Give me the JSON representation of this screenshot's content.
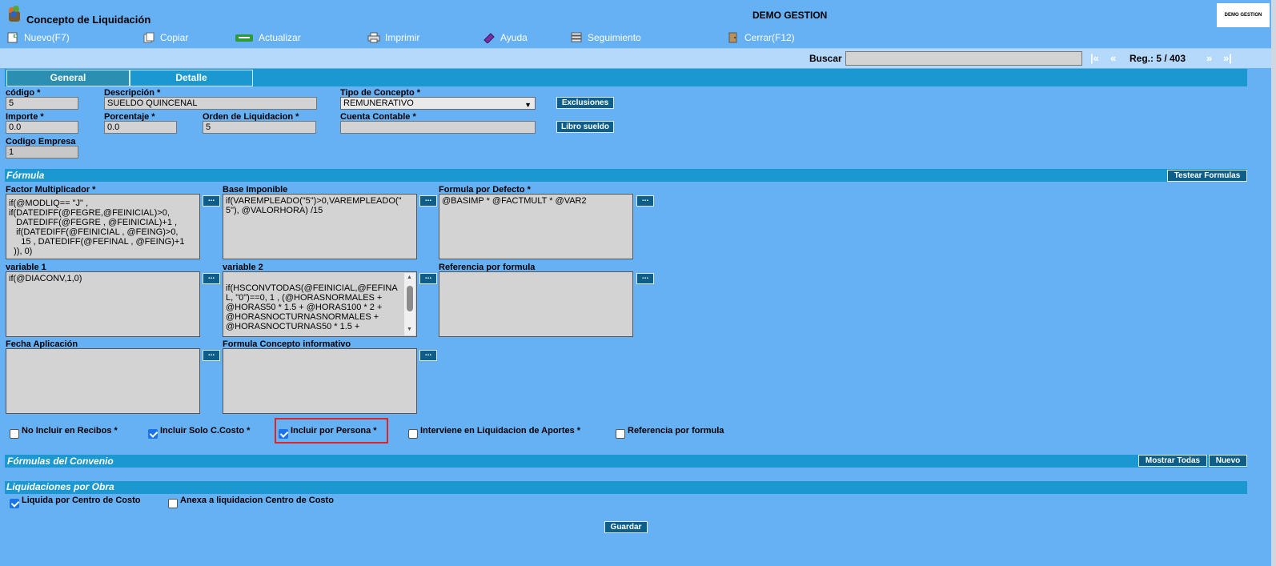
{
  "window": {
    "title": "Concepto de Liquidación",
    "company": "DEMO GESTION",
    "logo_text": "DEMO GESTION"
  },
  "toolbar": {
    "nuevo": "Nuevo(F7)",
    "copiar": "Copiar",
    "actualizar": "Actualizar",
    "imprimir": "Imprimir",
    "ayuda": "Ayuda",
    "seguimiento": "Seguimiento",
    "cerrar": "Cerrar(F12)"
  },
  "search": {
    "label": "Buscar",
    "value": "",
    "first": "|«",
    "prev": "«",
    "next": "»",
    "last": "»|",
    "reg": "Reg.: 5 / 403"
  },
  "tabs": {
    "general": "General",
    "detalle": "Detalle"
  },
  "form": {
    "codigo_label": "código *",
    "codigo": "5",
    "descripcion_label": "Descripción *",
    "descripcion": "SUELDO QUINCENAL",
    "tipo_label": "Tipo de Concepto *",
    "tipo": "REMUNERATIVO",
    "exclusiones": "Exclusiones",
    "importe_label": "Importe *",
    "importe": "0.0",
    "porcentaje_label": "Porcentaje *",
    "porcentaje": "0.0",
    "orden_label": "Orden de Liquidacion *",
    "orden": "5",
    "cuenta_label": "Cuenta Contable *",
    "cuenta": "",
    "libro_sueldo": "Libro sueldo",
    "empresa_label": "Codigo Empresa",
    "empresa": "1"
  },
  "formula": {
    "title": "Fórmula",
    "testear": "Testear Formulas",
    "dots": "...",
    "factor_label": "Factor Multiplicador *",
    "factor": "if(@MODLIQ== \"J\" ,\nif(DATEDIFF(@FEGRE,@FEINICIAL)>0,\n   DATEDIFF(@FEGRE , @FEINICIAL)+1 ,\n   if(DATEDIFF(@FEINICIAL , @FEING)>0,\n     15 , DATEDIFF(@FEFINAL , @FEING)+1\n  )), 0)",
    "base_label": "Base Imponible",
    "base": "if(VAREMPLEADO(\"5\")>0,VAREMPLEADO(\"\n5\"), @VALORHORA) /15",
    "defecto_label": "Formula por Defecto *",
    "defecto": "@BASIMP * @FACTMULT * @VAR2",
    "var1_label": "variable 1",
    "var1": "if(@DIACONV,1,0)",
    "var2_label": "variable 2",
    "var2": "if(HSCONVTODAS(@FEINICIAL,@FEFINA\nL, \"0\")==0, 1 , (@HORASNORMALES +\n@HORAS50 * 1.5 + @HORAS100 * 2 +\n@HORASNOCTURNASNORMALES +\n@HORASNOCTURNAS50 * 1.5 +",
    "referencia_label": "Referencia por formula",
    "referencia": "",
    "fecha_label": "Fecha Aplicación",
    "fecha": "",
    "informativo_label": "Formula Concepto informativo",
    "informativo": ""
  },
  "checks": {
    "no_incluir": "No Incluir en Recibos *",
    "solo_ccosto": "Incluir Solo C.Costo *",
    "por_persona": "Incluir por Persona *",
    "interviene": "Interviene en Liquidacion de Aportes *",
    "referencia": "Referencia por formula"
  },
  "convenio": {
    "title": "Fórmulas del Convenio",
    "mostrar": "Mostrar Todas",
    "nuevo": "Nuevo"
  },
  "obra": {
    "title": "Liquidaciones por Obra",
    "liquida": "Liquida por Centro de Costo",
    "anexa": "Anexa a liquidacion Centro de Costo",
    "guardar": "Guardar"
  },
  "colors": {
    "background": "#66b0f4",
    "section": "#1c98d1",
    "button": "#0d5f8a",
    "highlight": "#e02424"
  }
}
